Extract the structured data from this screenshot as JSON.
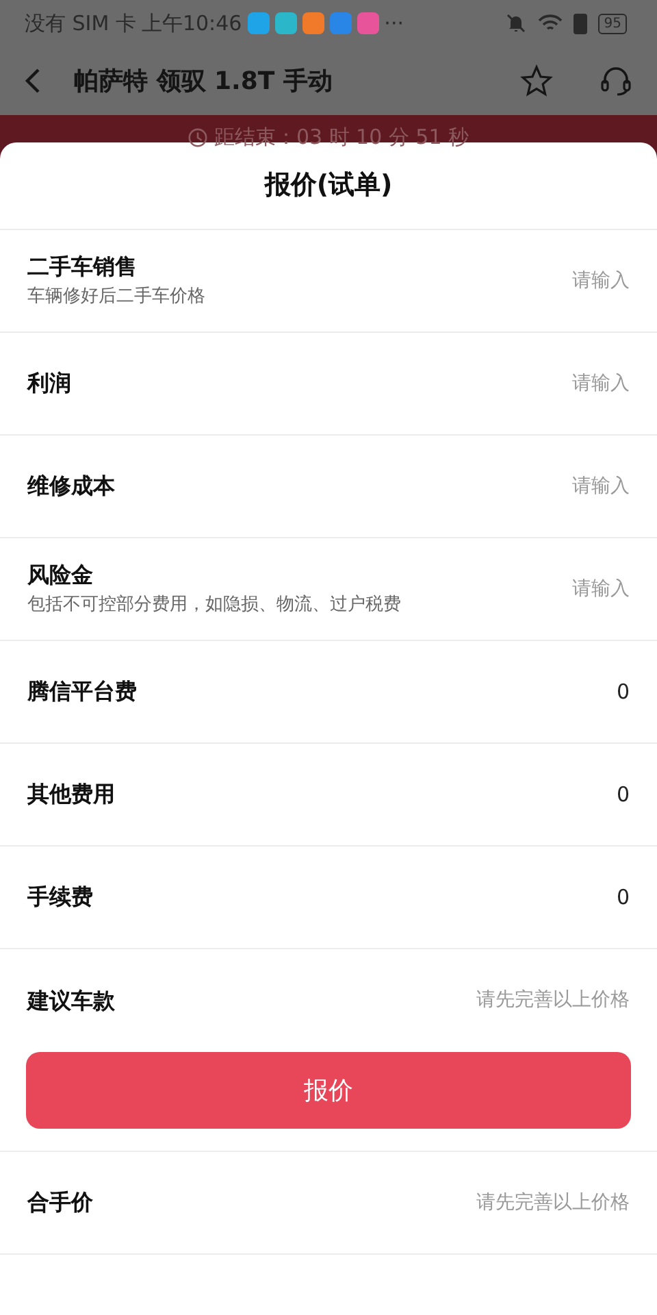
{
  "status_bar": {
    "carrier": "没有 SIM 卡",
    "time": "上午10:46",
    "more": "···",
    "battery": "95"
  },
  "header": {
    "title": "帕萨特 领驭 1.8T 手动"
  },
  "countdown": {
    "text": "距结束：03 时 10 分 51 秒"
  },
  "sheet": {
    "title": "报价(试单)",
    "rows": [
      {
        "label": "二手车销售",
        "sub": "车辆修好后二手车价格",
        "placeholder": "请输入"
      },
      {
        "label": "利润",
        "placeholder": "请输入"
      },
      {
        "label": "维修成本",
        "placeholder": "请输入"
      },
      {
        "label": "风险金",
        "sub": "包括不可控部分费用，如隐损、物流、过户税费",
        "placeholder": "请输入"
      },
      {
        "label": "腾信平台费",
        "value": "0"
      },
      {
        "label": "其他费用",
        "value": "0"
      },
      {
        "label": "手续费",
        "value": "0"
      },
      {
        "label": "建议车款",
        "placeholder": "请先完善以上价格"
      }
    ],
    "button": "报价",
    "footer_rows": [
      {
        "label": "合手价",
        "placeholder": "请先完善以上价格"
      }
    ]
  }
}
